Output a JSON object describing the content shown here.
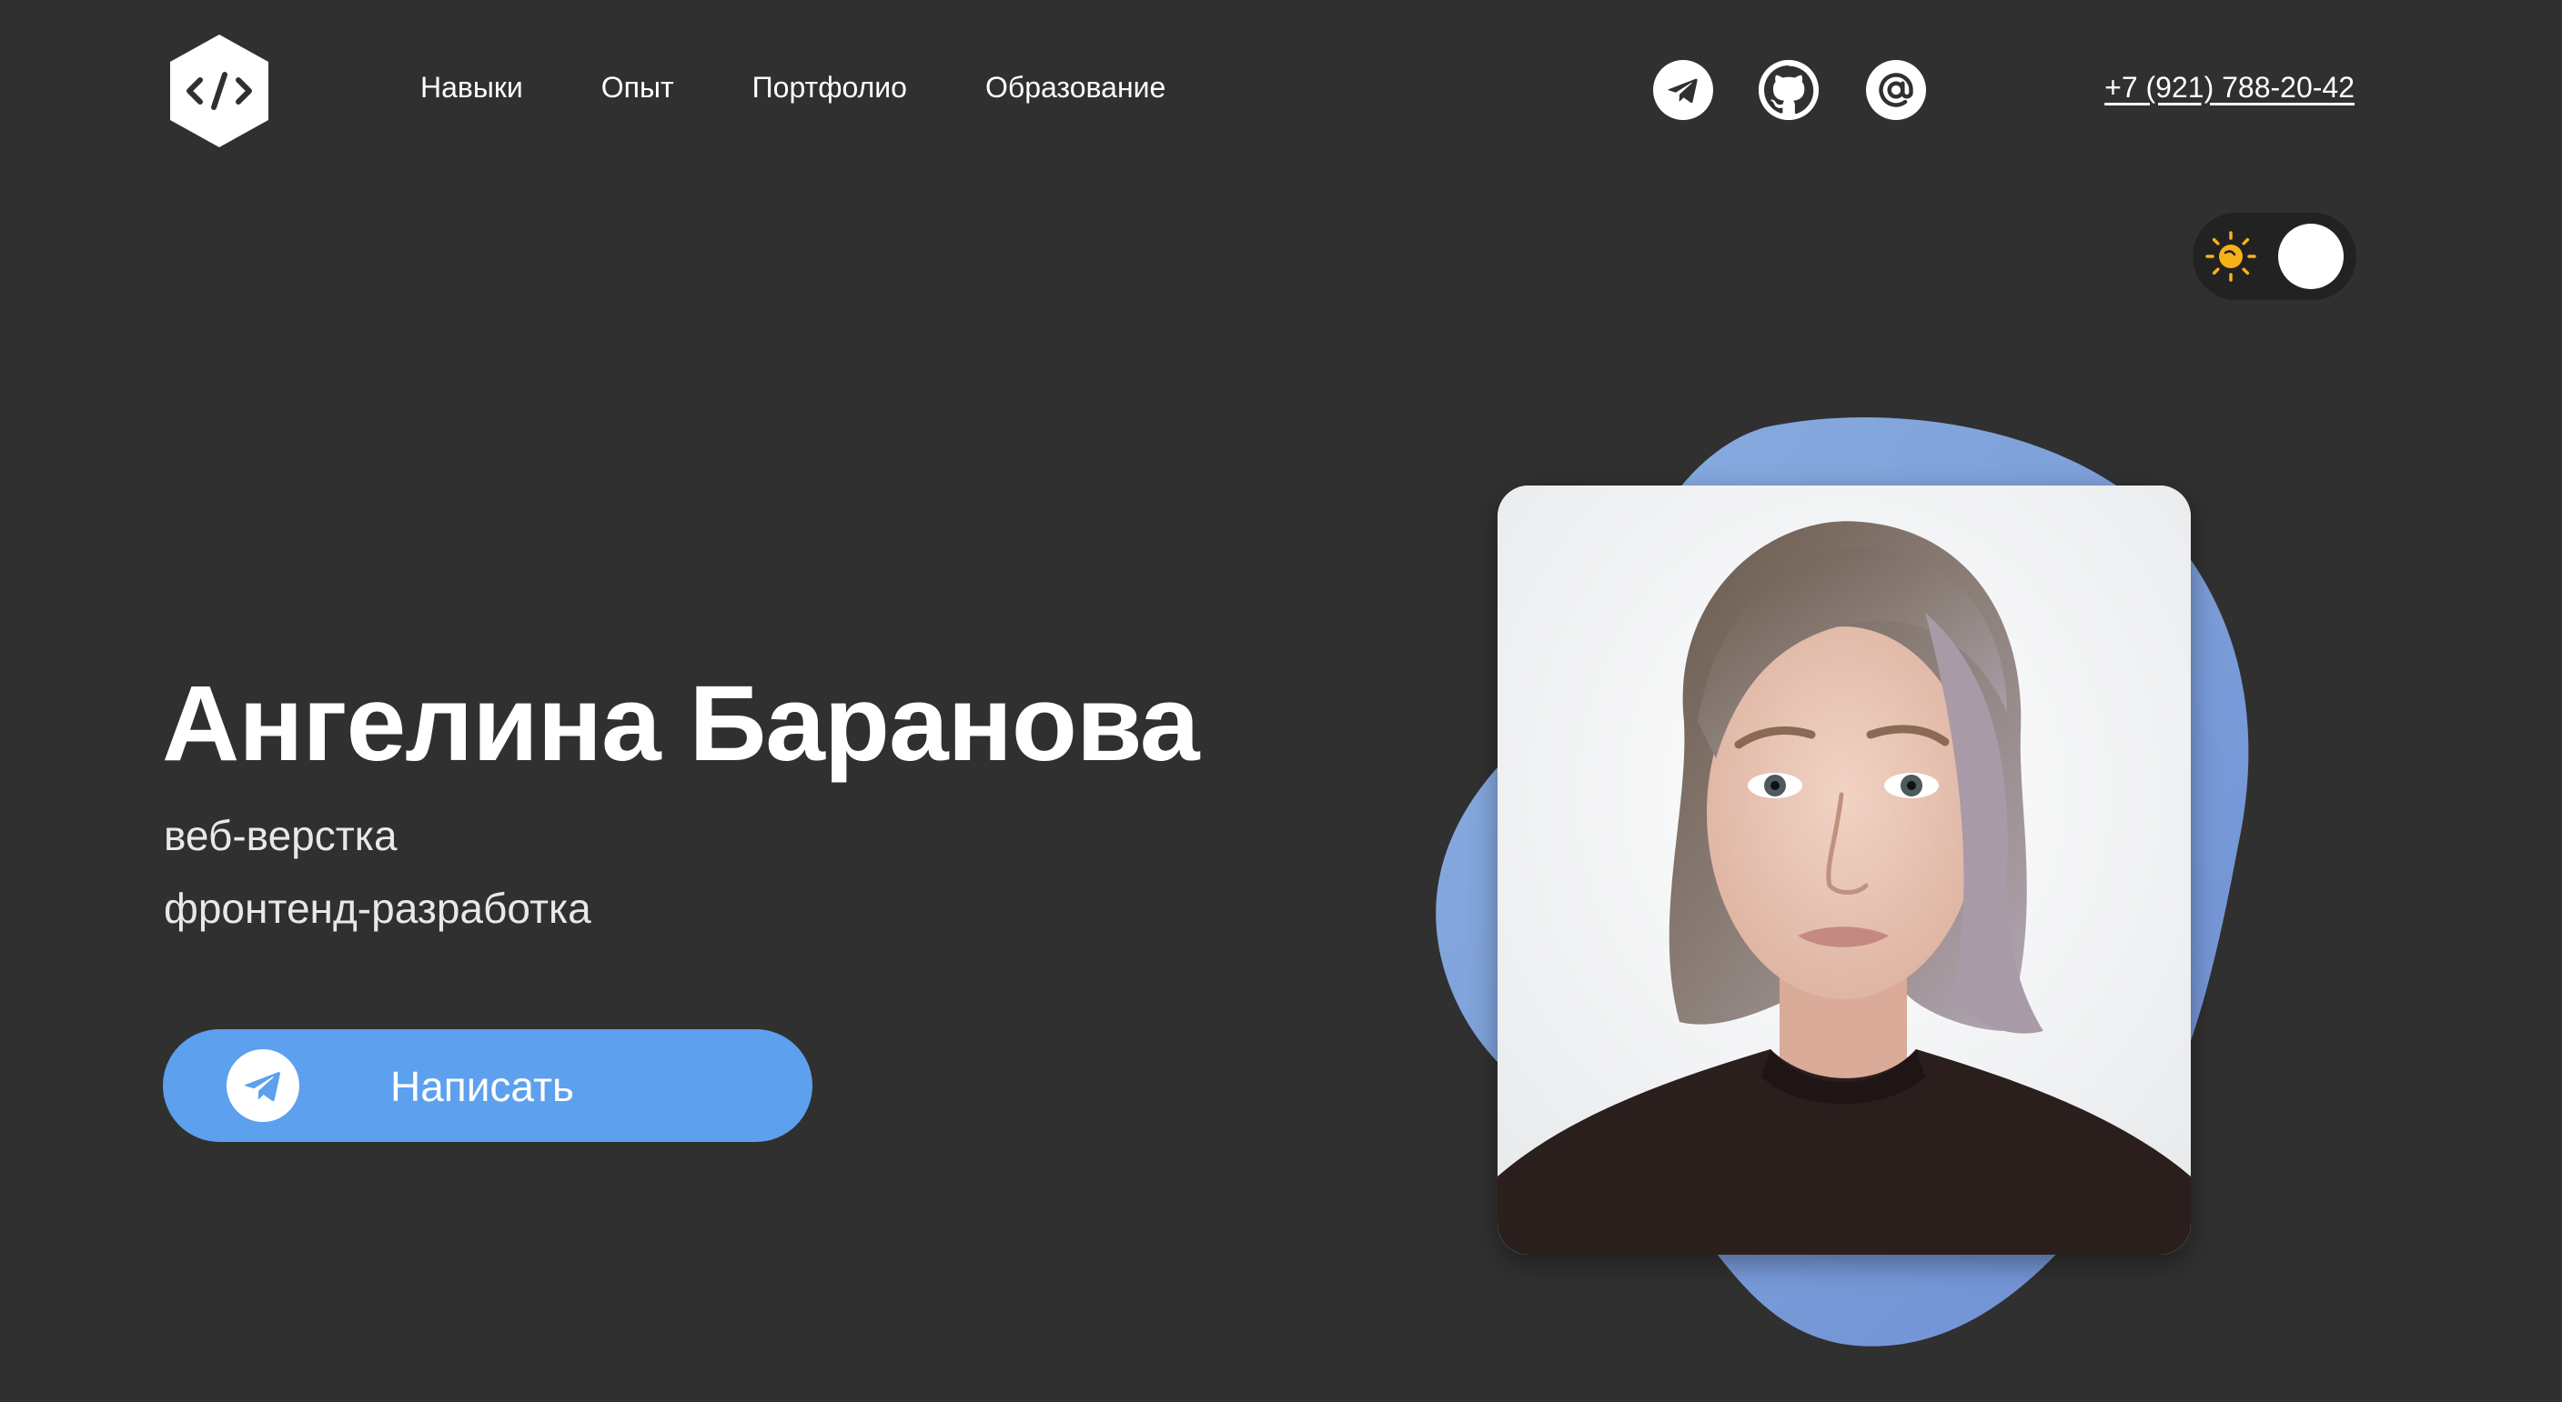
{
  "header": {
    "logo_icon": "code-brackets-icon",
    "nav": [
      {
        "label": "Навыки"
      },
      {
        "label": "Опыт"
      },
      {
        "label": "Портфолио"
      },
      {
        "label": "Образование"
      }
    ],
    "socials": [
      {
        "icon": "telegram-icon"
      },
      {
        "icon": "github-icon"
      },
      {
        "icon": "at-sign-icon"
      }
    ],
    "phone": "+7 (921) 788-20-42"
  },
  "theme_toggle": {
    "icon": "sun-icon",
    "state": "light-off"
  },
  "hero": {
    "name": "Ангелина Баранова",
    "roles": [
      "веб-верстка",
      "фронтенд-разработка"
    ],
    "cta": {
      "label": "Написать",
      "icon": "telegram-icon"
    }
  },
  "photo": {
    "shape_color": "#7b9fd9"
  },
  "colors": {
    "background": "#303030",
    "accent": "#5da0ee",
    "sun": "#f6b21b"
  }
}
